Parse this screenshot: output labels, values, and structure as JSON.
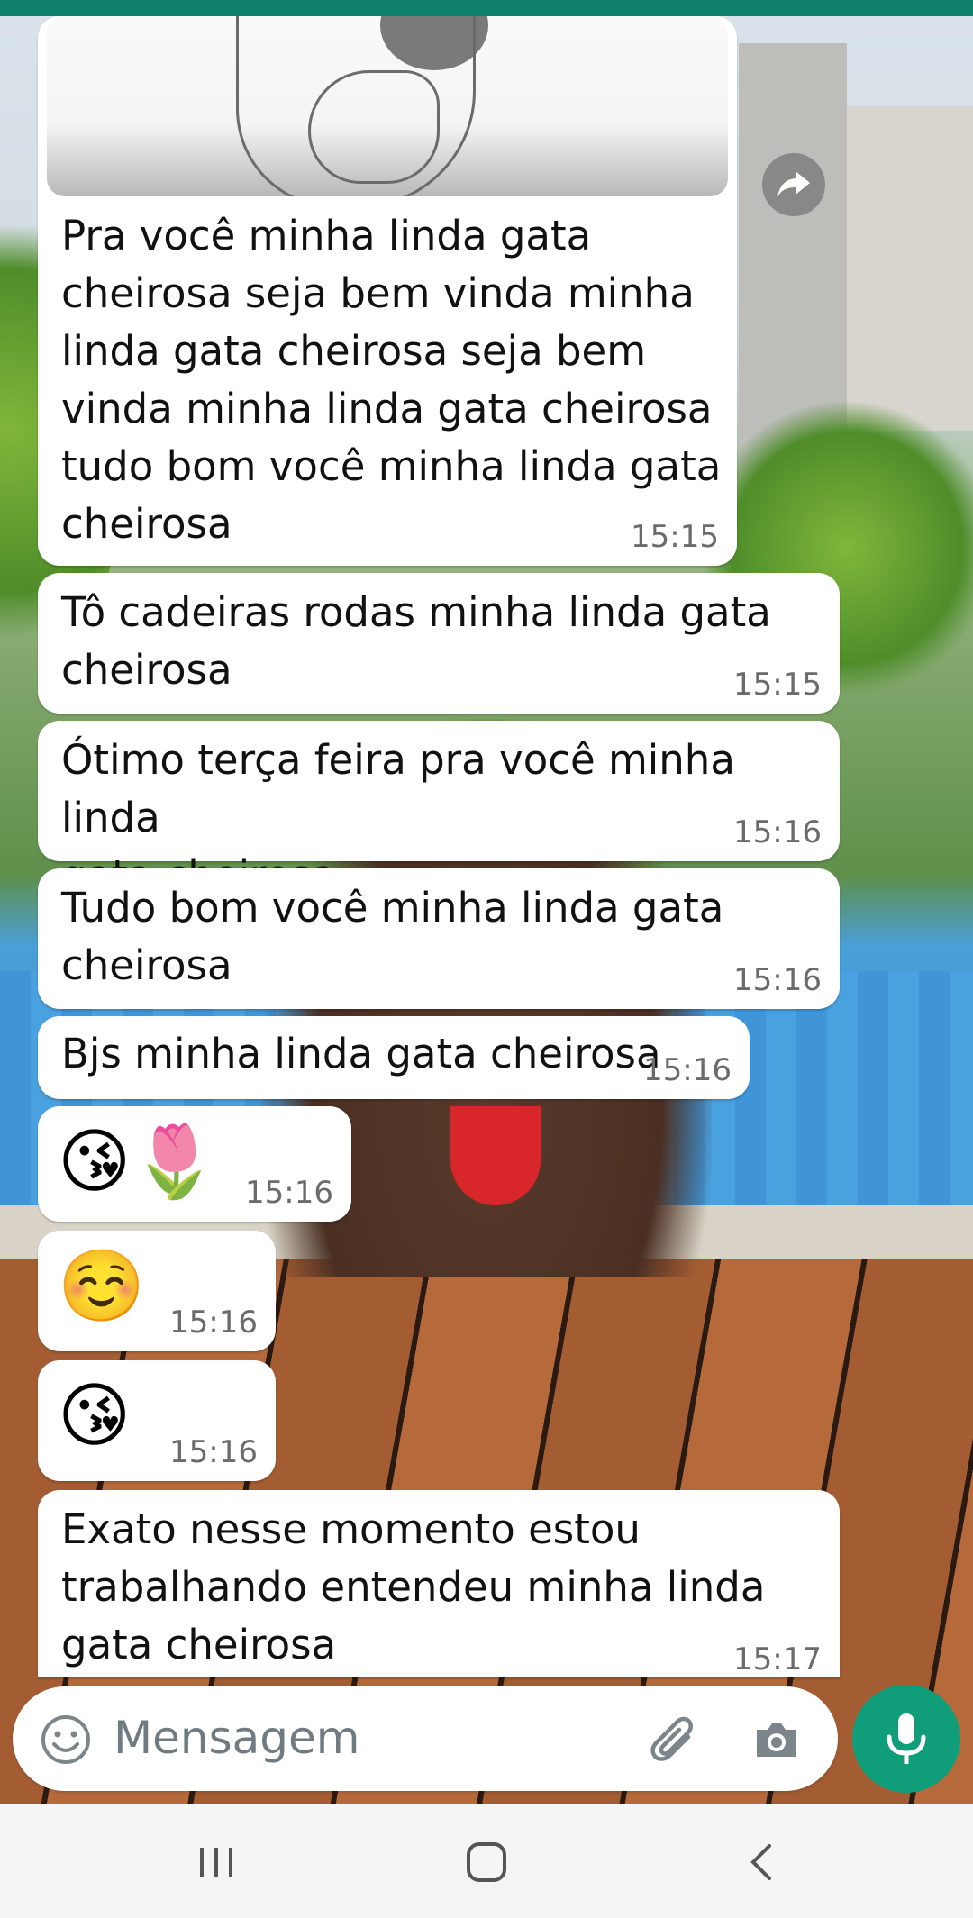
{
  "messages": [
    {
      "text": "Pra você minha linda gata\ncheirosa seja bem vinda minha\nlinda gata cheirosa seja bem\nvinda minha linda gata cheirosa\ntudo bom você minha linda gata\ncheirosa",
      "time": "15:15"
    },
    {
      "text": "Tô cadeiras rodas minha linda gata\ncheirosa",
      "time": "15:15"
    },
    {
      "text": "Ótimo terça feira pra você minha linda\ngata cheirosa",
      "time": "15:16"
    },
    {
      "text": "Tudo bom você minha linda gata\ncheirosa",
      "time": "15:16"
    },
    {
      "text": "Bjs minha linda gata cheirosa",
      "time": "15:16"
    },
    {
      "text": "😘🌷",
      "time": "15:16"
    },
    {
      "text": "☺️",
      "time": "15:16"
    },
    {
      "text": "😘",
      "time": "15:16"
    },
    {
      "text": "Exato nesse momento estou\ntrabalhando entendeu minha linda\ngata cheirosa",
      "time": "15:17"
    }
  ],
  "input": {
    "placeholder": "Mensagem"
  },
  "icons": {
    "forward": "forward-icon",
    "emoji": "emoji-icon",
    "attach": "paperclip-icon",
    "camera": "camera-icon",
    "mic": "mic-icon",
    "nav_recent": "recent-apps-icon",
    "nav_home": "home-icon",
    "nav_back": "back-icon"
  },
  "colors": {
    "accent": "#0f9d7a",
    "topbar": "#0d7f6a",
    "bubble": "#ffffff"
  }
}
